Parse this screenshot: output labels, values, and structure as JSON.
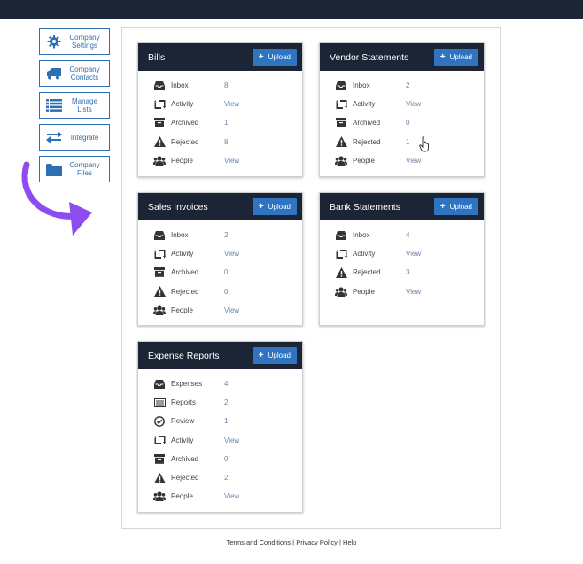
{
  "sidebar": {
    "items": [
      {
        "label": "Company Settings",
        "icon": "gear-icon"
      },
      {
        "label": "Company Contacts",
        "icon": "truck-icon"
      },
      {
        "label": "Manage Lists",
        "icon": "list-icon"
      },
      {
        "label": "Integrate",
        "icon": "swap-arrows-icon"
      },
      {
        "label": "Company Files",
        "icon": "folder-icon"
      }
    ]
  },
  "colors": {
    "accent": "#2e74c0",
    "header_bg": "#1c2536",
    "arrow": "#8e4cf0",
    "link": "#6b85a8"
  },
  "upload_label": "Upload",
  "cards": {
    "bills": {
      "title": "Bills",
      "rows": [
        {
          "label": "Inbox",
          "value": "8",
          "icon": "inbox-icon"
        },
        {
          "label": "Activity",
          "value": "View",
          "icon": "retweet-icon"
        },
        {
          "label": "Archived",
          "value": "1",
          "icon": "archive-icon"
        },
        {
          "label": "Rejected",
          "value": "8",
          "icon": "warning-icon"
        },
        {
          "label": "People",
          "value": "View",
          "icon": "people-icon"
        }
      ]
    },
    "vendor": {
      "title": "Vendor Statements",
      "rows": [
        {
          "label": "Inbox",
          "value": "2",
          "icon": "inbox-icon"
        },
        {
          "label": "Activity",
          "value": "View",
          "icon": "retweet-icon"
        },
        {
          "label": "Archived",
          "value": "0",
          "icon": "archive-icon"
        },
        {
          "label": "Rejected",
          "value": "1",
          "icon": "warning-icon"
        },
        {
          "label": "People",
          "value": "View",
          "icon": "people-icon"
        }
      ]
    },
    "sales": {
      "title": "Sales Invoices",
      "rows": [
        {
          "label": "Inbox",
          "value": "2",
          "icon": "inbox-icon"
        },
        {
          "label": "Activity",
          "value": "View",
          "icon": "retweet-icon"
        },
        {
          "label": "Archived",
          "value": "0",
          "icon": "archive-icon"
        },
        {
          "label": "Rejected",
          "value": "0",
          "icon": "warning-icon"
        },
        {
          "label": "People",
          "value": "View",
          "icon": "people-icon"
        }
      ]
    },
    "bank": {
      "title": "Bank Statements",
      "rows": [
        {
          "label": "Inbox",
          "value": "4",
          "icon": "inbox-icon"
        },
        {
          "label": "Activity",
          "value": "View",
          "icon": "retweet-icon"
        },
        {
          "label": "Rejected",
          "value": "3",
          "icon": "warning-icon"
        },
        {
          "label": "People",
          "value": "View",
          "icon": "people-icon"
        }
      ]
    },
    "expense": {
      "title": "Expense Reports",
      "rows": [
        {
          "label": "Expenses",
          "value": "4",
          "icon": "inbox-icon"
        },
        {
          "label": "Reports",
          "value": "2",
          "icon": "list-box-icon"
        },
        {
          "label": "Review",
          "value": "1",
          "icon": "check-circle-icon"
        },
        {
          "label": "Activity",
          "value": "View",
          "icon": "retweet-icon"
        },
        {
          "label": "Archived",
          "value": "0",
          "icon": "archive-icon"
        },
        {
          "label": "Rejected",
          "value": "2",
          "icon": "warning-icon"
        },
        {
          "label": "People",
          "value": "View",
          "icon": "people-icon"
        }
      ]
    }
  },
  "footer": {
    "terms": "Terms and Conditions",
    "privacy": "Privacy Policy",
    "help": "Help",
    "sep": "|"
  }
}
